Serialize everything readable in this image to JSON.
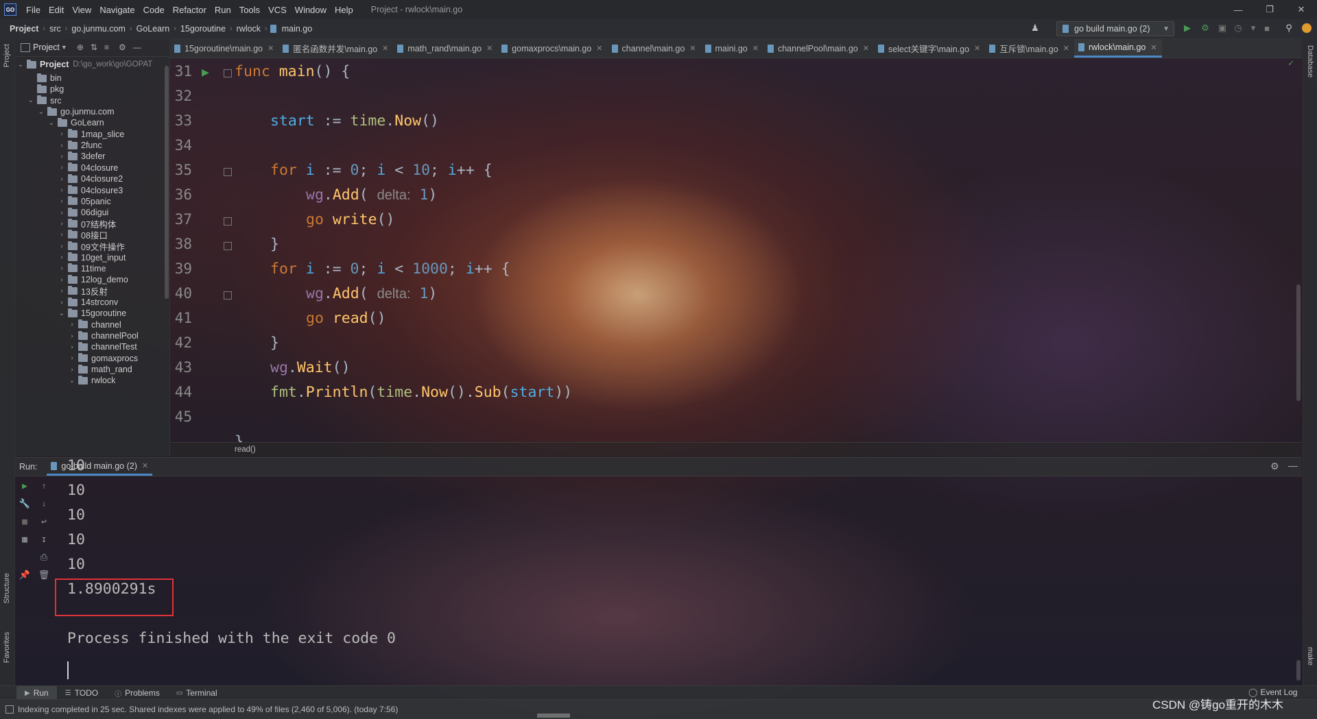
{
  "colors": {
    "accent": "#4a88c7",
    "run_green": "#499c54",
    "highlight_box": "#e0323a",
    "keyword": "#cc7832",
    "function": "#ffc66d"
  },
  "menubar": {
    "logo": "GO",
    "items": [
      "File",
      "Edit",
      "View",
      "Navigate",
      "Code",
      "Refactor",
      "Run",
      "Tools",
      "VCS",
      "Window",
      "Help"
    ],
    "window_title": "Project - rwlock\\main.go"
  },
  "navbar": {
    "crumbs": [
      "Project",
      "src",
      "go.junmu.com",
      "GoLearn",
      "15goroutine",
      "rwlock",
      "main.go"
    ],
    "run_config": "go build main.go (2)"
  },
  "left_strip": {
    "project": "Project",
    "structure": "Structure",
    "favorites": "Favorites"
  },
  "right_strip": {
    "database": "Database",
    "make": "make"
  },
  "project_panel": {
    "header": "Project",
    "root_label": "Project",
    "root_path": "D:\\go_work\\go\\GOPAT",
    "tree": [
      {
        "label": "bin",
        "depth": 1,
        "arrow": ""
      },
      {
        "label": "pkg",
        "depth": 1,
        "arrow": ""
      },
      {
        "label": "src",
        "depth": 1,
        "arrow": "⌄"
      },
      {
        "label": "go.junmu.com",
        "depth": 2,
        "arrow": "⌄"
      },
      {
        "label": "GoLearn",
        "depth": 3,
        "arrow": "⌄"
      },
      {
        "label": "1map_slice",
        "depth": 4,
        "arrow": "›"
      },
      {
        "label": "2func",
        "depth": 4,
        "arrow": "›"
      },
      {
        "label": "3defer",
        "depth": 4,
        "arrow": "›"
      },
      {
        "label": "04closure",
        "depth": 4,
        "arrow": "›"
      },
      {
        "label": "04closure2",
        "depth": 4,
        "arrow": "›"
      },
      {
        "label": "04closure3",
        "depth": 4,
        "arrow": "›"
      },
      {
        "label": "05panic",
        "depth": 4,
        "arrow": "›"
      },
      {
        "label": "06digui",
        "depth": 4,
        "arrow": "›"
      },
      {
        "label": "07结构体",
        "depth": 4,
        "arrow": "›"
      },
      {
        "label": "08接口",
        "depth": 4,
        "arrow": "›"
      },
      {
        "label": "09文件操作",
        "depth": 4,
        "arrow": "›"
      },
      {
        "label": "10get_input",
        "depth": 4,
        "arrow": "›"
      },
      {
        "label": "11time",
        "depth": 4,
        "arrow": "›"
      },
      {
        "label": "12log_demo",
        "depth": 4,
        "arrow": "›"
      },
      {
        "label": "13反射",
        "depth": 4,
        "arrow": "›"
      },
      {
        "label": "14strconv",
        "depth": 4,
        "arrow": "›"
      },
      {
        "label": "15goroutine",
        "depth": 4,
        "arrow": "⌄"
      },
      {
        "label": "channel",
        "depth": 5,
        "arrow": "›"
      },
      {
        "label": "channelPool",
        "depth": 5,
        "arrow": "›"
      },
      {
        "label": "channelTest",
        "depth": 5,
        "arrow": "›"
      },
      {
        "label": "gomaxprocs",
        "depth": 5,
        "arrow": "›"
      },
      {
        "label": "math_rand",
        "depth": 5,
        "arrow": "›"
      },
      {
        "label": "rwlock",
        "depth": 5,
        "arrow": "⌄"
      }
    ]
  },
  "tabs": [
    "15goroutine\\main.go",
    "匿名函数并发\\main.go",
    "math_rand\\main.go",
    "gomaxprocs\\main.go",
    "channel\\main.go",
    "maini.go",
    "channelPool\\main.go",
    "select关键字\\main.go",
    "互斥锁\\main.go",
    "rwlock\\main.go"
  ],
  "editor": {
    "line_numbers": [
      "31",
      "32",
      "33",
      "34",
      "35",
      "36",
      "37",
      "38",
      "39",
      "40",
      "41",
      "42",
      "43",
      "44",
      "45"
    ],
    "partial_line": "}",
    "bottom_crumb": "read()"
  },
  "run_panel": {
    "label": "Run:",
    "tab": "go build main.go (2)",
    "output": [
      "10",
      "10",
      "10",
      "10",
      "10",
      "1.8900291s",
      "",
      "Process finished with the exit code 0"
    ]
  },
  "bottom_tabs": [
    "Run",
    "TODO",
    "Problems",
    "Terminal"
  ],
  "event_log": "Event Log",
  "status": "Indexing completed in 25 sec. Shared indexes were applied to 49% of files (2,460 of 5,006). (today 7:56)",
  "watermark": "CSDN @铸go重开的木木"
}
